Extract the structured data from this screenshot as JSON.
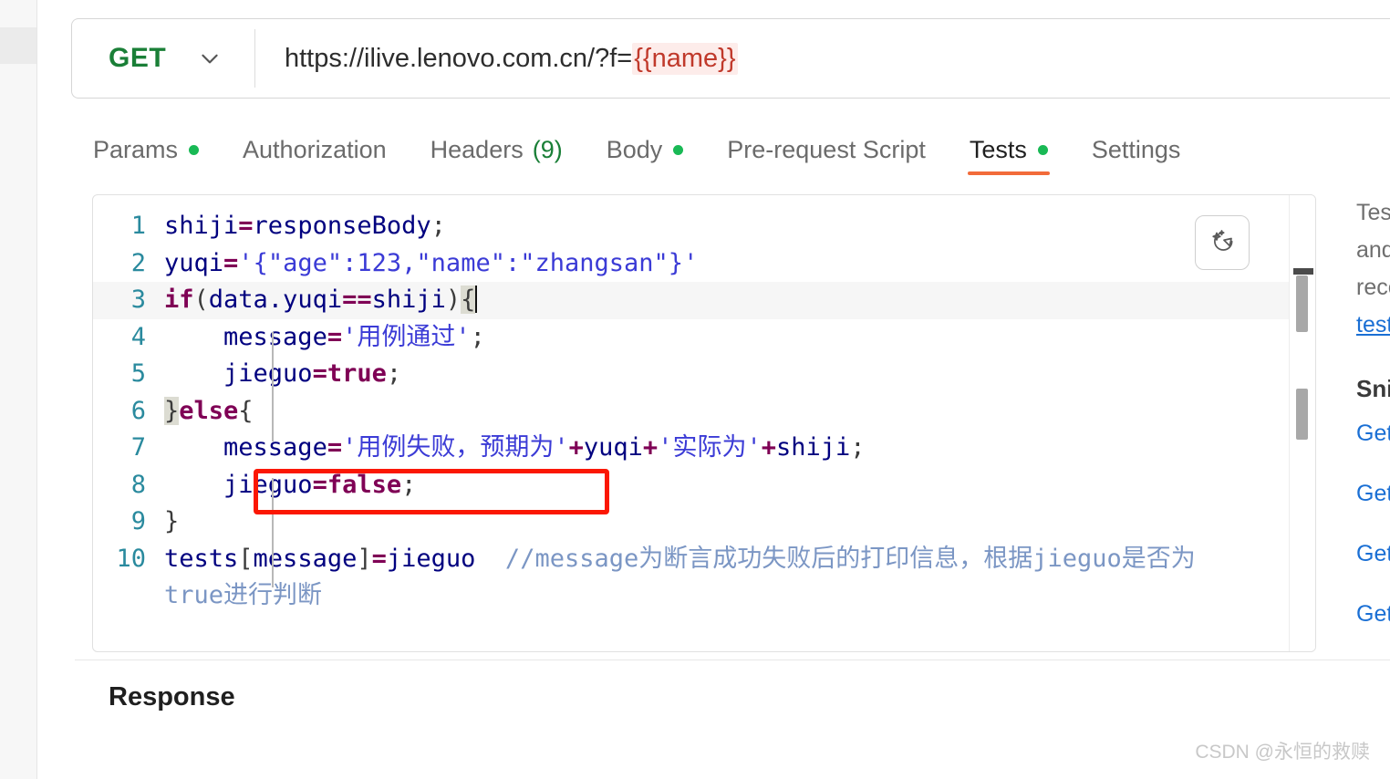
{
  "request_bar": {
    "method": "GET",
    "chevron_icon": "chevron-down-icon",
    "url_prefix": "https://ilive.lenovo.com.cn/?f=",
    "url_variable": "{{name}}"
  },
  "tabs": [
    {
      "label": "Params",
      "dot": true,
      "count": null,
      "active": false
    },
    {
      "label": "Authorization",
      "dot": false,
      "count": null,
      "active": false
    },
    {
      "label": "Headers",
      "dot": false,
      "count": "(9)",
      "active": false
    },
    {
      "label": "Body",
      "dot": true,
      "count": null,
      "active": false
    },
    {
      "label": "Pre-request Script",
      "dot": false,
      "count": null,
      "active": false
    },
    {
      "label": "Tests",
      "dot": true,
      "count": null,
      "active": true
    },
    {
      "label": "Settings",
      "dot": false,
      "count": null,
      "active": false
    }
  ],
  "editor": {
    "magic_icon": "sparkle-ai-icon",
    "line_numbers": [
      "1",
      "2",
      "3",
      "4",
      "5",
      "6",
      "7",
      "8",
      "9",
      "10"
    ],
    "lines": {
      "l1": {
        "id1": "shiji",
        "op": "=",
        "id2": "responseBody",
        "semi": ";"
      },
      "l2": {
        "id": "yuqi",
        "op": "=",
        "quote": "'",
        "brace_open": "{",
        "k1": "\"age\"",
        "colon1": ":",
        "num": "123",
        "comma": ",",
        "k2": "\"name\"",
        "colon2": ":",
        "v2": "\"zhangsan\"",
        "brace_close": "}",
        "quote_end": "'"
      },
      "l3": {
        "kw": "if",
        "paren_open": "(",
        "obj": "data.yuqi",
        "op": "==",
        "id": "shiji",
        "paren_close": ")",
        "brace": "{"
      },
      "l4": {
        "indent": "    ",
        "id": "message",
        "op": "=",
        "quote1": "'",
        "str": "用例通过",
        "quote2": "'",
        "semi": ";"
      },
      "l5": {
        "indent": "    ",
        "id": "jieguo",
        "op": "=",
        "kw": "true",
        "semi": ";"
      },
      "l6": {
        "brace_close": "}",
        "kw": "else",
        "brace_open": "{"
      },
      "l7": {
        "indent": "    ",
        "id": "message",
        "op": "=",
        "q1": "'",
        "s1": "用例失败，预期为",
        "q2": "'",
        "plus1": "+",
        "v1": "yuqi",
        "plus2": "+",
        "q3": "'",
        "s2": "实际为",
        "q4": "'",
        "plus3": "+",
        "v2": "shiji",
        "semi": ";"
      },
      "l8": {
        "indent": "    ",
        "id": "jieguo",
        "op": "=",
        "kw": "false",
        "semi": ";"
      },
      "l9": {
        "brace_close": "}"
      },
      "l10": {
        "id": "tests",
        "bracket_open": "[",
        "key": "message",
        "bracket_close": "]",
        "op": "=",
        "val": "jieguo",
        "comment": "  //message为断言成功失败后的打印信息，根据jieguo是否为",
        "comment_wrap": "    true进行判断"
      }
    }
  },
  "help_panel": {
    "paragraph_lines": [
      "Test scri",
      "and are r",
      "received"
    ],
    "doc_link": "tests sc",
    "snippets_title": "Snippet",
    "snippet_links": [
      "Get an e",
      "Get a glo",
      "Get a va",
      "Get a co"
    ]
  },
  "response": {
    "title": "Response"
  },
  "watermark": {
    "text": "CSDN @永恒的救赎"
  },
  "colors": {
    "method_green": "#1a7f37",
    "tab_dot_green": "#19b955",
    "active_tab_underline": "#f26b3a",
    "url_variable_red": "#c0392b",
    "url_variable_bg": "#fdecea",
    "annotation_red": "#fb1703",
    "line_number_teal": "#2a8a9e",
    "identifier_navy": "#00007f",
    "keyword_maroon": "#7f0055",
    "string_blue": "#3b3bd6",
    "comment_blue_gray": "#7b96c4",
    "link_blue": "#1a6fd4"
  }
}
